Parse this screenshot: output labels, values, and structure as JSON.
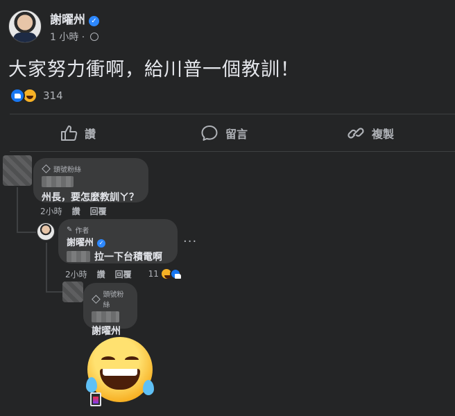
{
  "post": {
    "author": "謝曜州",
    "time": "1 小時",
    "text": "大家努力衝啊，給川普一個教訓！",
    "reaction_count": "314"
  },
  "actions": {
    "like": "讚",
    "comment": "留言",
    "copy": "複製"
  },
  "comments": [
    {
      "badge": "頭號粉絲",
      "text": "州長，要怎麼教訓ㄚ？",
      "time": "2小時",
      "like": "讚",
      "reply": "回覆"
    },
    {
      "badge": "作者",
      "author": "謝曜州",
      "text": "拉一下台積電啊",
      "time": "2小時",
      "like": "讚",
      "reply": "回覆",
      "reaction_count": "11",
      "more": "···"
    },
    {
      "badge": "頭號粉絲",
      "text": "謝曜州"
    }
  ],
  "icons": [
    "verified-icon",
    "globe-icon",
    "like-icon",
    "haha-icon",
    "comment-icon",
    "share-icon",
    "diamond-icon",
    "pencil-icon",
    "sticker-icon"
  ],
  "colors": {
    "background": "#242526",
    "bubble": "#3a3b3c",
    "accent": "#2d88ff"
  }
}
